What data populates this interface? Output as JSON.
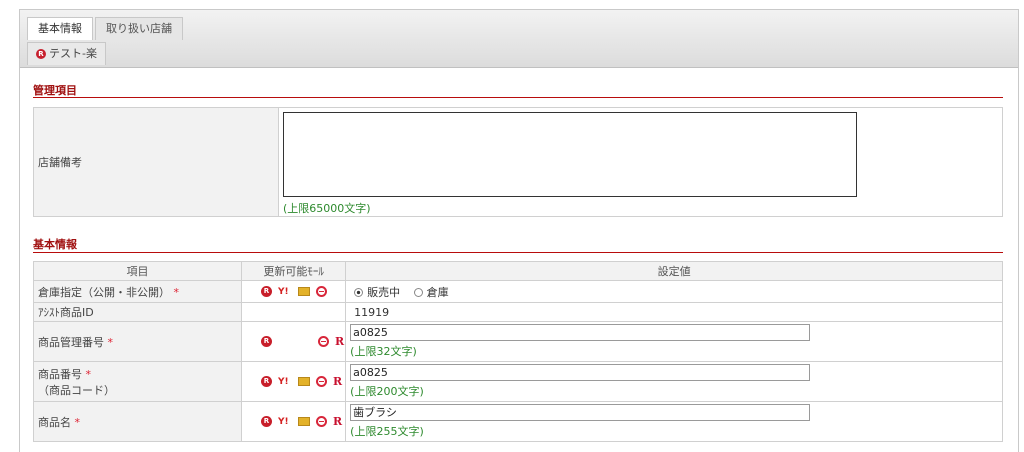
{
  "tabs": {
    "active": "基本情報",
    "inactive": "取り扱い店舗",
    "sub": "テスト-楽"
  },
  "sections": {
    "admin": "管理項目",
    "basic": "基本情報"
  },
  "store_note": {
    "label": "店舗備考",
    "value": "",
    "limit": "(上限65000文字)"
  },
  "basic_table": {
    "headers": {
      "item": "項目",
      "updatable": "更新可能ﾓｰﾙ",
      "value": "設定値"
    },
    "rows": {
      "warehouse": {
        "label": "倉庫指定（公開・非公開）",
        "req": "*",
        "opt_sale": "販売中",
        "opt_stock": "倉庫"
      },
      "assist_id": {
        "label": "ｱｼｽﾄ商品ID",
        "value": "11919"
      },
      "mgmt_no": {
        "label": "商品管理番号",
        "req": "*",
        "value": "a0825",
        "limit": "(上限32文字)"
      },
      "item_no": {
        "label": "商品番号",
        "req": "*",
        "sub": "（商品コード）",
        "value": "a0825",
        "limit": "(上限200文字)"
      },
      "name": {
        "label": "商品名",
        "req": "*",
        "value": "歯ブラシ",
        "limit": "(上限255文字)"
      }
    }
  },
  "icons": {
    "r_mark": "R",
    "y_mark": "Y!"
  },
  "colors": {
    "section": "#a01010",
    "limit_text": "#2e8a2e",
    "required": "#d23"
  }
}
